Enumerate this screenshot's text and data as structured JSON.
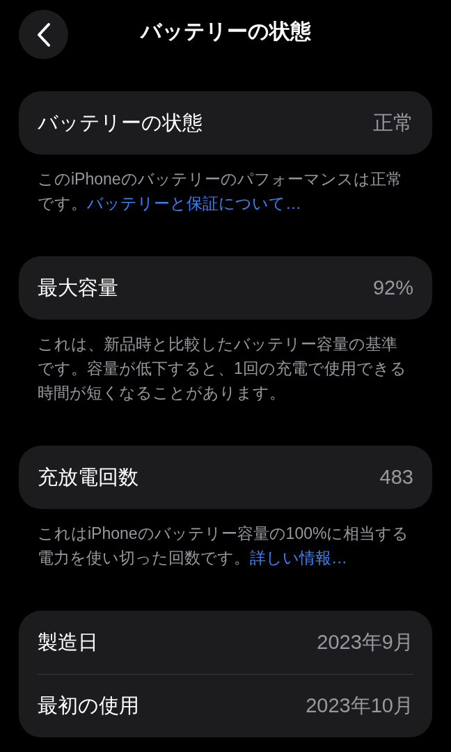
{
  "header": {
    "title": "バッテリーの状態"
  },
  "sections": [
    {
      "rows": [
        {
          "label": "バッテリーの状態",
          "value": "正常"
        }
      ],
      "note": {
        "text": "このiPhoneのバッテリーのパフォーマンスは正常です。",
        "link": "バッテリーと保証について…"
      }
    },
    {
      "rows": [
        {
          "label": "最大容量",
          "value": "92%"
        }
      ],
      "note": {
        "text": "これは、新品時と比較したバッテリー容量の基準です。容量が低下すると、1回の充電で使用できる時間が短くなることがあります。"
      }
    },
    {
      "rows": [
        {
          "label": "充放電回数",
          "value": "483"
        }
      ],
      "note": {
        "text": "これはiPhoneのバッテリー容量の100%に相当する電力を使い切った回数です。",
        "link": "詳しい情報…"
      }
    },
    {
      "rows": [
        {
          "label": "製造日",
          "value": "2023年9月"
        },
        {
          "label": "最初の使用",
          "value": "2023年10月"
        }
      ]
    }
  ]
}
